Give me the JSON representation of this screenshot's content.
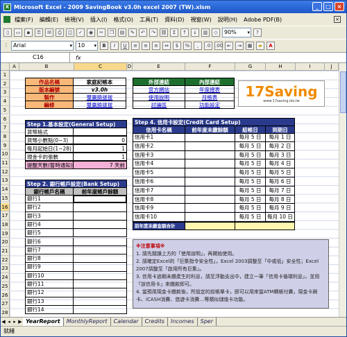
{
  "window": {
    "title": "Microsoft Excel - 2009 SavingBook v3.0h excel 2007 (TW).xlsm"
  },
  "menu": [
    "檔案(F)",
    "編輯(E)",
    "檢視(V)",
    "插入(I)",
    "格式(O)",
    "工具(T)",
    "資料(D)",
    "視窗(W)",
    "說明(H)",
    "Adobe PDF(B)"
  ],
  "toolbar": {
    "zoom": "90%",
    "font": "Arial",
    "size": "10"
  },
  "formula": {
    "namebox": "C16",
    "fx": "fx"
  },
  "columns": [
    "A",
    "B",
    "C",
    "D",
    "E",
    "F",
    "G",
    "H",
    "I",
    "J"
  ],
  "info": {
    "name_label": "作品名稱",
    "name_val": "家庭記帳本",
    "ver_label": "版本編號",
    "ver_val": "v3.0h",
    "author_label": "製作",
    "author_val": "雙贏臉拔拔",
    "editor_label": "編修",
    "editor_val": "雙贏臉拔拔"
  },
  "links": {
    "ext_head": "外部連結",
    "int_head": "內部連結",
    "ext": [
      "官方網站",
      "使用說明",
      "討論區"
    ],
    "int": [
      "年度總表",
      "月帳表",
      "功能設定"
    ]
  },
  "logo": {
    "text": "17Saving",
    "sub": "www.17saving.idv.tw"
  },
  "step1": {
    "title": "Step 1.基本設定(General Setup)",
    "rows": [
      {
        "label": "貨幣格式",
        "val": ""
      },
      {
        "label": "貨幣小數點(0~3)",
        "val": "0"
      },
      {
        "label": "每月起始日(1~28)",
        "val": "1"
      },
      {
        "label": "現金卡的張數",
        "val": "1"
      },
      {
        "label": "提醒天數(暫時通知)",
        "val": "7 天前"
      }
    ]
  },
  "step2": {
    "title": "Step 2. 銀行帳戶設定(Bank Setup)",
    "col1": "銀行帳戶名稱",
    "col2": "前年度帳戶餘額",
    "rows": [
      "銀行1",
      "銀行2",
      "銀行3",
      "銀行4",
      "銀行5",
      "銀行6",
      "銀行7",
      "銀行8",
      "銀行9",
      "銀行10",
      "銀行11",
      "銀行12",
      "銀行13",
      "銀行14"
    ]
  },
  "step4": {
    "title": "Step 4. 信用卡設定(Credit Card Setup)",
    "cols": [
      "信用卡名稱",
      "前年度未繳餘額",
      "結帳日",
      "到期日"
    ],
    "rows": [
      [
        "信用卡1",
        "每月 5 日",
        "每月 1 日"
      ],
      [
        "信用卡2",
        "每月 5 日",
        "每月 2 日"
      ],
      [
        "信用卡3",
        "每月 5 日",
        "每月 3 日"
      ],
      [
        "信用卡4",
        "每月 5 日",
        "每月 4 日"
      ],
      [
        "信用卡5",
        "每月 5 日",
        "每月 5 日"
      ],
      [
        "信用卡6",
        "每月 5 日",
        "每月 6 日"
      ],
      [
        "信用卡7",
        "每月 5 日",
        "每月 7 日"
      ],
      [
        "信用卡8",
        "每月 5 日",
        "每月 8 日"
      ],
      [
        "信用卡9",
        "每月 5 日",
        "每月 9 日"
      ],
      [
        "信用卡10",
        "每月 5 日",
        "每月 10 日"
      ]
    ],
    "total": "前年度未繳金額合計"
  },
  "notes": {
    "title": "※注意事項※",
    "lines": [
      "1. 請先閱讀上方的「使用說明」，再開始使用。",
      "2. 請確定Excel的「巨集指令安全性」，Excel 2003調整至「中或低」安全性；Excel 2007調整至「啟用所有巨集」。",
      "3. 信用卡過期未繳產生的利息，請至浮動支出中，建立一筆「信用卡循環利息」，並用「該信用卡」來繳款即可。",
      "4. 當預用現金卡繳款後，所設定的前帳單卡，即可以用來當ATM轉帳付費，現金卡刷卡、iCASH消費、悠遊卡消費…等類似儲值卡功能。"
    ]
  },
  "tabs": [
    "YearReport",
    "MonthlyReport",
    "Calendar",
    "Credits",
    "Incomes",
    "Sper"
  ],
  "status": "就緒"
}
